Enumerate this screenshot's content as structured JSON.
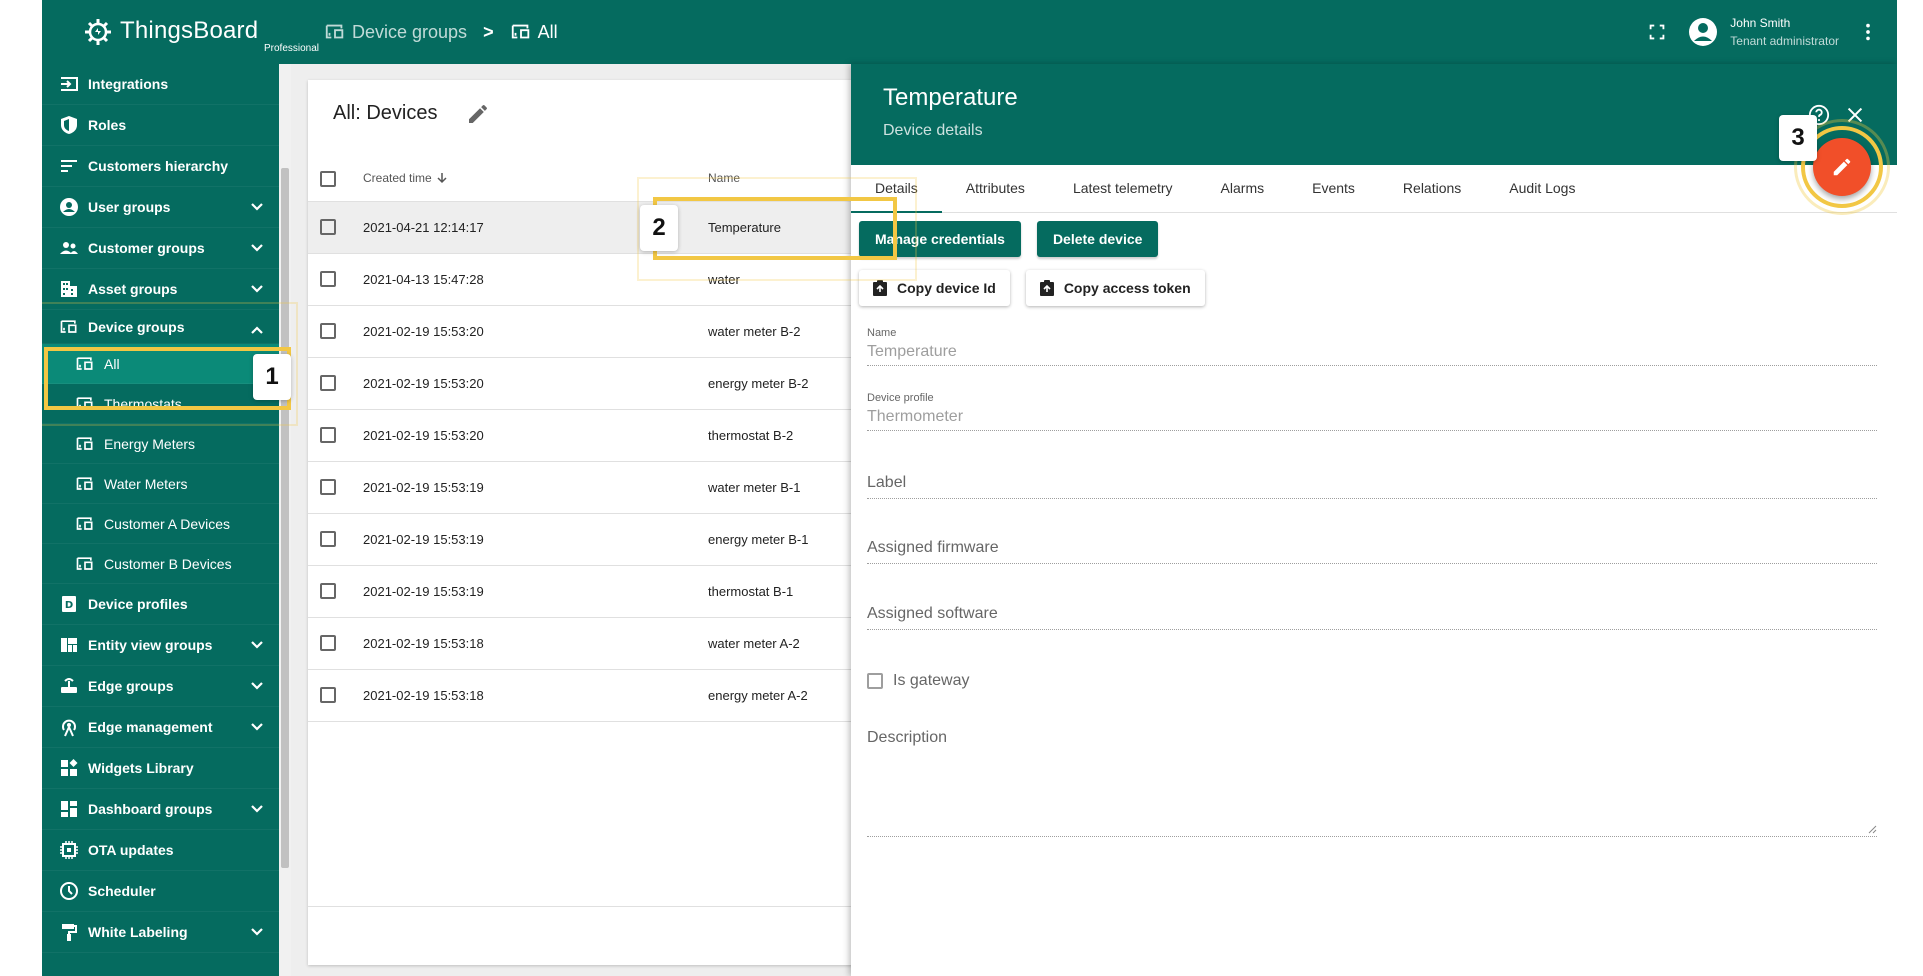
{
  "brand": {
    "name": "ThingsBoard",
    "edition": "Professional"
  },
  "breadcrumb": {
    "parent": "Device groups",
    "separator": ">",
    "current": "All"
  },
  "user": {
    "name": "John Smith",
    "role": "Tenant administrator"
  },
  "colors": {
    "primary": "#056b5f",
    "accent": "#f14f29",
    "highlight": "#f2c744"
  },
  "sidebar": {
    "items": [
      {
        "label": "Integrations",
        "icon": "integrations-icon"
      },
      {
        "label": "Roles",
        "icon": "shield-icon"
      },
      {
        "label": "Customers hierarchy",
        "icon": "hierarchy-icon"
      },
      {
        "label": "User groups",
        "icon": "account-circle-icon"
      },
      {
        "label": "Customer groups",
        "icon": "people-icon"
      },
      {
        "label": "Asset groups",
        "icon": "domain-icon"
      },
      {
        "label": "Device groups",
        "icon": "devices-icon"
      },
      {
        "label": "All",
        "icon": "devices-icon"
      },
      {
        "label": "Thermostats",
        "icon": "devices-icon"
      },
      {
        "label": "Energy Meters",
        "icon": "devices-icon"
      },
      {
        "label": "Water Meters",
        "icon": "devices-icon"
      },
      {
        "label": "Customer A Devices",
        "icon": "devices-icon"
      },
      {
        "label": "Customer B Devices",
        "icon": "devices-icon"
      },
      {
        "label": "Device profiles",
        "icon": "device-profile-icon"
      },
      {
        "label": "Entity view groups",
        "icon": "view-quilt-icon"
      },
      {
        "label": "Edge groups",
        "icon": "router-icon"
      },
      {
        "label": "Edge management",
        "icon": "antenna-icon"
      },
      {
        "label": "Widgets Library",
        "icon": "widgets-icon"
      },
      {
        "label": "Dashboard groups",
        "icon": "dashboard-icon"
      },
      {
        "label": "OTA updates",
        "icon": "memory-icon"
      },
      {
        "label": "Scheduler",
        "icon": "clock-icon"
      },
      {
        "label": "White Labeling",
        "icon": "format-paint-icon"
      }
    ]
  },
  "table": {
    "title": "All: Devices",
    "columns": {
      "created": "Created time",
      "name": "Name"
    },
    "rows": [
      {
        "created": "2021-04-21 12:14:17",
        "name": "Temperature"
      },
      {
        "created": "2021-04-13 15:47:28",
        "name": "water"
      },
      {
        "created": "2021-02-19 15:53:20",
        "name": "water meter B-2"
      },
      {
        "created": "2021-02-19 15:53:20",
        "name": "energy meter B-2"
      },
      {
        "created": "2021-02-19 15:53:20",
        "name": "thermostat B-2"
      },
      {
        "created": "2021-02-19 15:53:19",
        "name": "water meter B-1"
      },
      {
        "created": "2021-02-19 15:53:19",
        "name": "energy meter B-1"
      },
      {
        "created": "2021-02-19 15:53:19",
        "name": "thermostat B-1"
      },
      {
        "created": "2021-02-19 15:53:18",
        "name": "water meter A-2"
      },
      {
        "created": "2021-02-19 15:53:18",
        "name": "energy meter A-2"
      }
    ]
  },
  "detail": {
    "title": "Temperature",
    "subtitle": "Device details",
    "tabs": [
      "Details",
      "Attributes",
      "Latest telemetry",
      "Alarms",
      "Events",
      "Relations",
      "Audit Logs"
    ],
    "manage_credentials": "Manage credentials",
    "delete_device": "Delete device",
    "copy_device_id": "Copy device Id",
    "copy_access_token": "Copy access token",
    "fields": {
      "name_label": "Name",
      "name_value": "Temperature",
      "profile_label": "Device profile",
      "profile_value": "Thermometer",
      "label_placeholder": "Label",
      "firmware_placeholder": "Assigned firmware",
      "software_placeholder": "Assigned software",
      "gateway_label": "Is gateway",
      "description_placeholder": "Description"
    }
  },
  "callouts": {
    "one": "1",
    "two": "2",
    "three": "3"
  }
}
